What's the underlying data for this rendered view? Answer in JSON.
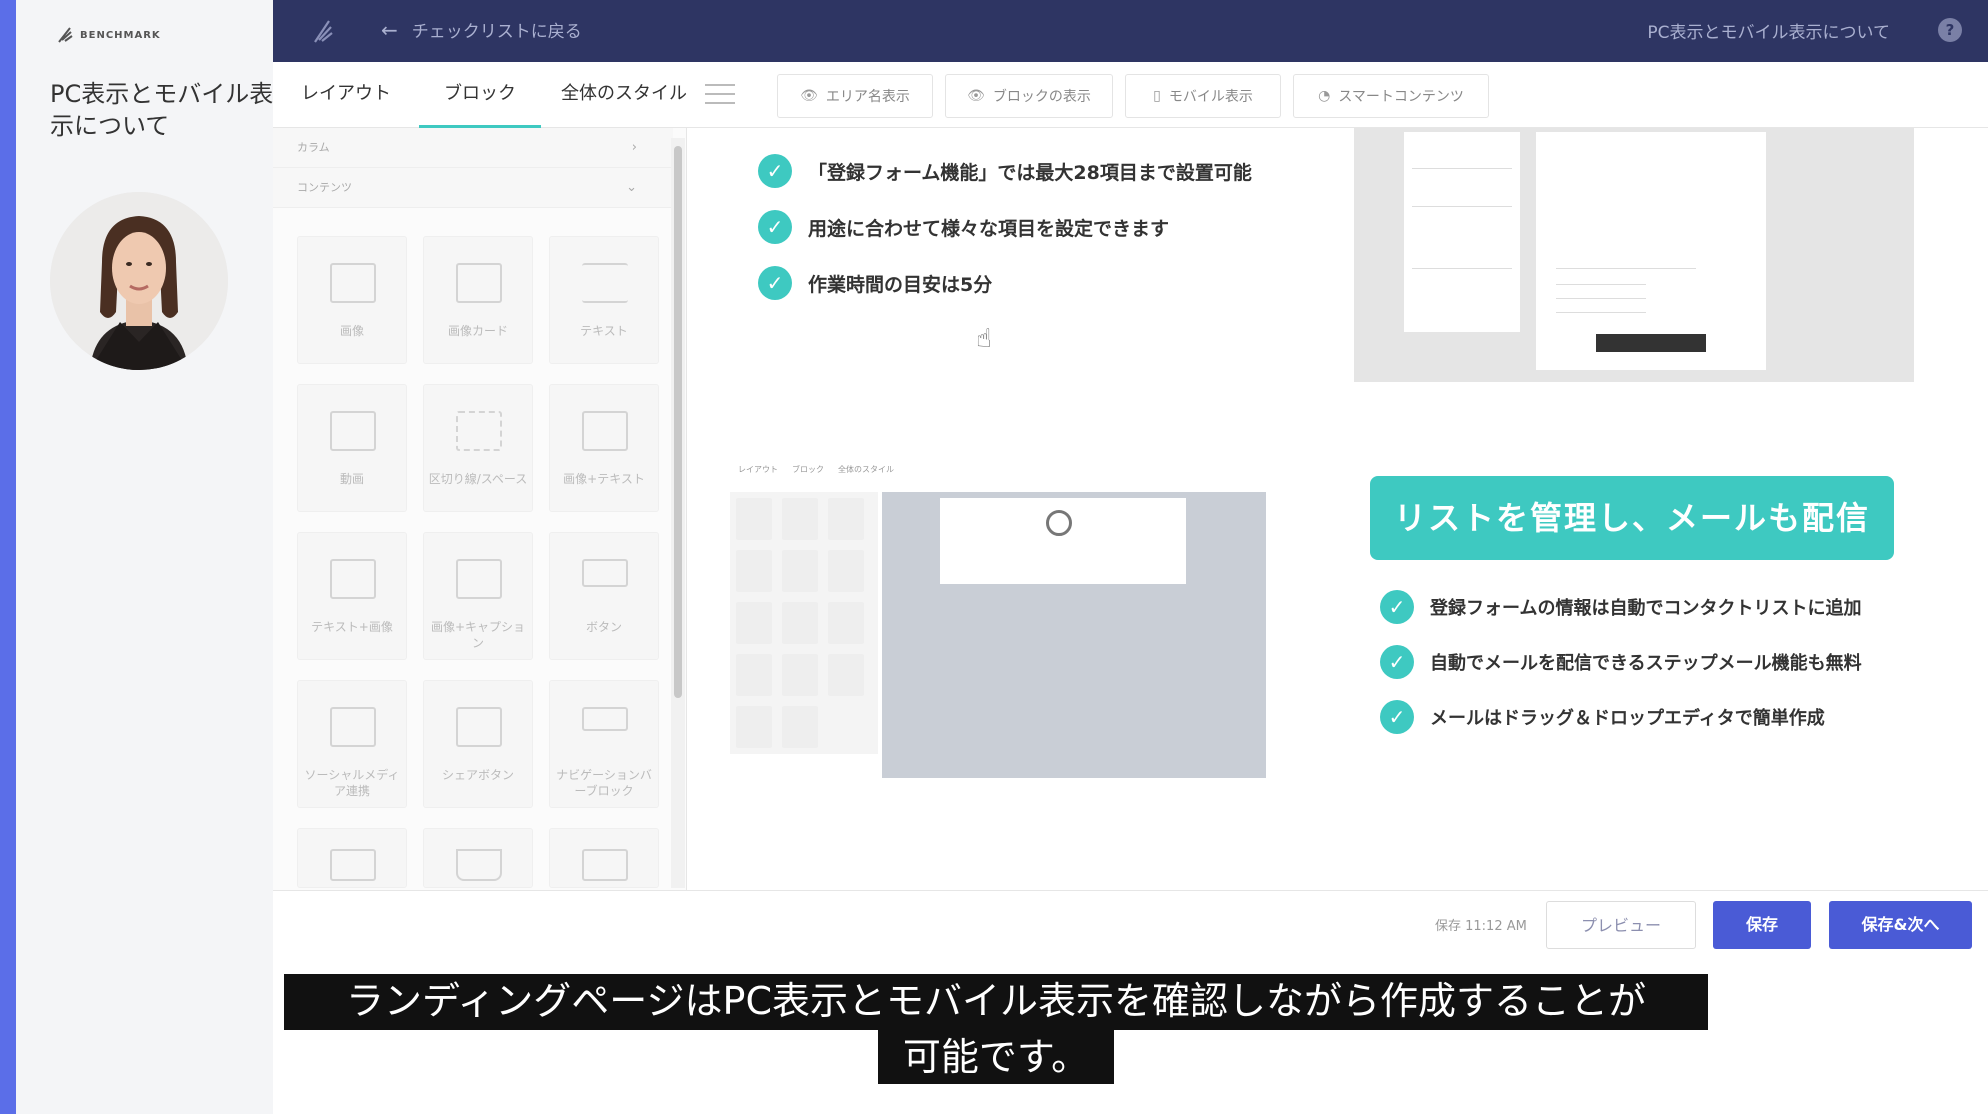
{
  "presenter": {
    "brand": "BENCHMARK",
    "title": "PC表示とモバイル表示について"
  },
  "topbar": {
    "back_label": "チェックリストに戻る",
    "page_name": "PC表示とモバイル表示について",
    "help": "?"
  },
  "tabs": [
    {
      "label": "レイアウト"
    },
    {
      "label": "ブロック"
    },
    {
      "label": "全体のスタイル"
    }
  ],
  "toggles": [
    {
      "label": "エリア名表示",
      "icon": "eye-icon"
    },
    {
      "label": "ブロックの表示",
      "icon": "eye-icon"
    },
    {
      "label": "モバイル表示",
      "icon": "mobile-icon"
    },
    {
      "label": "スマートコンテンツ",
      "icon": "smart-content-icon"
    }
  ],
  "block_panel": {
    "section_columns": "カラム",
    "section_contents": "コンテンツ",
    "blocks": [
      "画像",
      "画像カード",
      "テキスト",
      "動画",
      "区切り線/スペース",
      "画像+テキスト",
      "テキスト+画像",
      "画像+キャプション",
      "ボタン",
      "ソーシャルメディア連携",
      "シェアボタン",
      "ナビゲーションバーブロック"
    ]
  },
  "canvas": {
    "checks_top": [
      "「登録フォーム機能」では最大28項目まで設置可能",
      "用途に合わせて様々な項目を設定できます",
      "作業時間の目安は5分"
    ],
    "cta": "リストを管理し、メールも配信",
    "checks_bottom": [
      "登録フォームの情報は自動でコンタクトリストに追加",
      "自動でメールを配信できるステップメール機能も無料",
      "メールはドラッグ＆ドロップエディタで簡単作成"
    ],
    "mini_tabs": [
      "レイアウト",
      "ブロック",
      "全体のスタイル"
    ]
  },
  "footer": {
    "save_time": "保存 11:12 AM",
    "preview": "プレビュー",
    "save": "保存",
    "save_next": "保存&次へ"
  },
  "caption": {
    "line1": "ランディングページはPC表示とモバイル表示を確認しながら作成することが",
    "line2": "可能です。"
  },
  "colors": {
    "accent": "#3ec9c1",
    "topbar": "#2e3563",
    "primary_button": "#4a5bd6",
    "stripe": "#5b6ee8"
  }
}
